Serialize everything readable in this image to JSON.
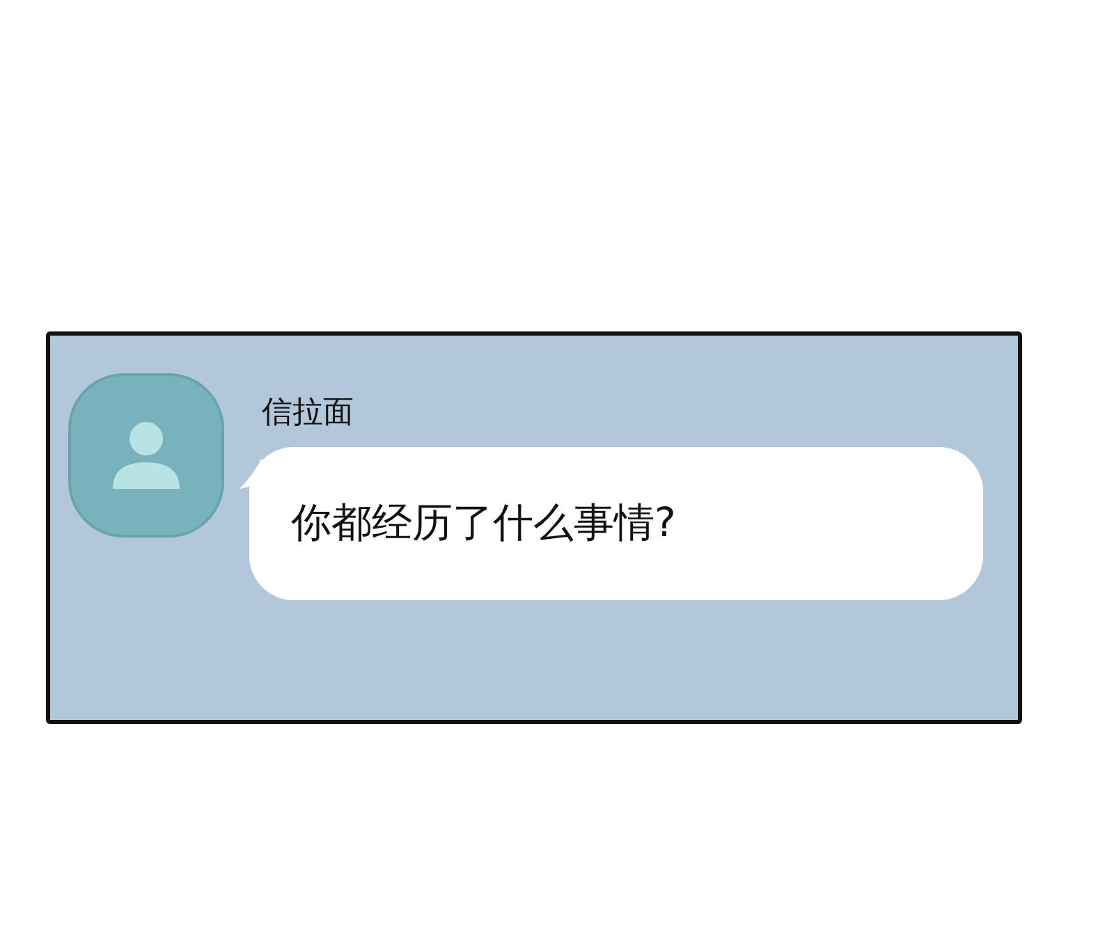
{
  "chat_message": {
    "sender": "信拉面",
    "text": "你都经历了什么事情?"
  }
}
